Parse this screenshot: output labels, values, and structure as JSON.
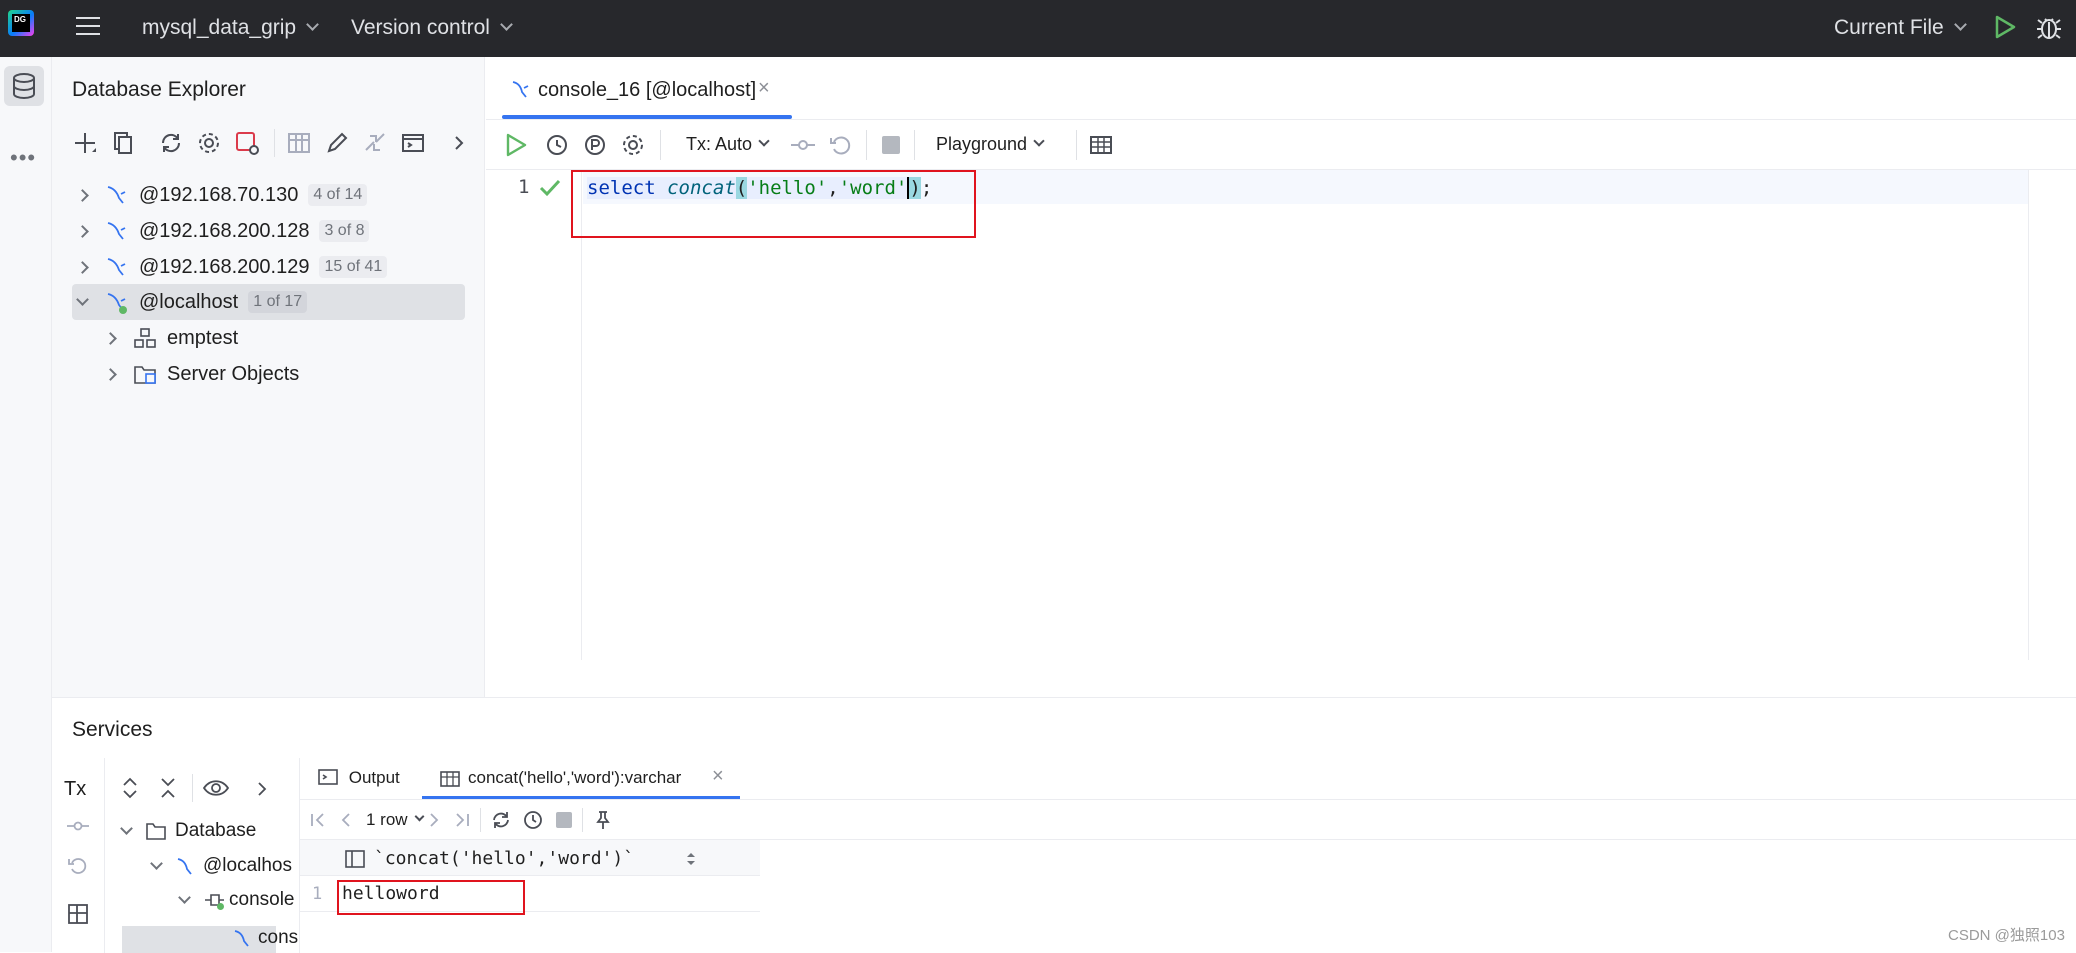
{
  "topbar": {
    "logo_text": "DG",
    "project": "mysql_data_grip",
    "vcs": "Version control",
    "run_config": "Current File"
  },
  "explorer": {
    "title": "Database Explorer",
    "items": [
      {
        "label": "@192.168.70.130",
        "badge": "4 of 14"
      },
      {
        "label": "@192.168.200.128",
        "badge": "3 of 8"
      },
      {
        "label": "@192.168.200.129",
        "badge": "15 of 41"
      },
      {
        "label": "@localhost",
        "badge": "1 of 17"
      }
    ],
    "children": [
      {
        "label": "emptest"
      },
      {
        "label": "Server Objects"
      }
    ]
  },
  "editor": {
    "tab_label": "console_16 [@localhost]",
    "tx_mode": "Tx: Auto",
    "mode": "Playground",
    "line_number": "1",
    "code": {
      "keyword": "select",
      "func": "concat",
      "open": "(",
      "arg1": "'hello'",
      "comma": ",",
      "arg2": "'word'",
      "close": ")",
      "semi": ";"
    }
  },
  "services": {
    "title": "Services",
    "tx_label": "Tx",
    "tabs": {
      "output": "Output",
      "result": "concat('hello','word'):varchar"
    },
    "rows_label": "1 row",
    "tree": {
      "database": "Database",
      "localhost": "@localhos",
      "console": "console",
      "cons": "cons"
    },
    "result": {
      "column": "`concat('hello','word')`",
      "row_number": "1",
      "value": "helloword"
    }
  },
  "watermark": "CSDN @独照103",
  "colors": {
    "topbar_bg": "#27282c",
    "accent_blue": "#3574f0",
    "run_green": "#5fb865",
    "highlight_red": "#e0141e",
    "keyword_blue": "#0033b3",
    "string_green": "#067d17",
    "func_blue": "#00627a"
  }
}
